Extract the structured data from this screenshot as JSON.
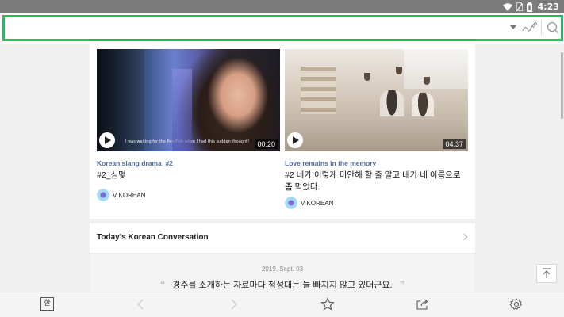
{
  "status_bar": {
    "time": "4:23",
    "icons": [
      "wifi-icon",
      "sim-icon",
      "battery-icon"
    ]
  },
  "search": {
    "value": "",
    "placeholder": "",
    "accent_color": "#1fc25a",
    "icons": [
      "dropdown-arrow-icon",
      "handwriting-icon",
      "search-icon"
    ]
  },
  "videos": [
    {
      "category": "Korean slang drama_#2",
      "title": "#2_심멎",
      "caption": "I was waiting for the Pan-Fish when I had this sudden thought!",
      "duration": "00:20",
      "channel": "V KOREAN"
    },
    {
      "category": "Love remains in the memory",
      "title": "#2 네가 이렇게 미안해 할 줄 알고 내가 네 이름으로 좀 먹었다.",
      "caption": "",
      "duration": "04:37",
      "channel": "V KOREAN"
    }
  ],
  "conversation": {
    "header": "Today's Korean Conversation",
    "date": "2019. Sept. 03",
    "open_quote": "❝",
    "close_quote": "❞",
    "sentence": "경주를 소개하는 자료마다 첨성대는 늘 빠지지 않고 있더군요."
  },
  "bottom_nav": {
    "han_label": "한",
    "items": [
      "back-icon",
      "forward-icon",
      "star-icon",
      "share-icon",
      "settings-icon"
    ]
  },
  "colors": {
    "category_link": "#4c6a9c",
    "status_bar": "#7b7b7b",
    "background": "#f0f0f0"
  }
}
